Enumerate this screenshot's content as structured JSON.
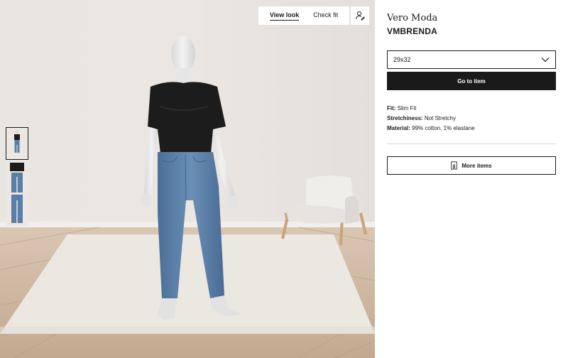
{
  "view_tabs": {
    "view_look": "View look",
    "check_fit": "Check fit",
    "active": "view_look"
  },
  "avatar_button": {
    "icon": "person-edit-icon"
  },
  "thumbnails": [
    {
      "name": "full-outfit",
      "active": true
    },
    {
      "name": "top-and-jeans",
      "active": false
    },
    {
      "name": "jeans-only",
      "active": false
    }
  ],
  "product": {
    "brand": "Vero Moda",
    "name": "VMBRENDA",
    "selected_size": "29x32",
    "go_to_item": "Go to item",
    "specs": [
      {
        "label": "Fit:",
        "value": "Slim Fit"
      },
      {
        "label": "Stretchiness:",
        "value": "Not Stretchy"
      },
      {
        "label": "Material:",
        "value": "99% cotton, 1% elastane"
      }
    ],
    "more_items": "More items",
    "more_items_icon": "pants-icon"
  },
  "colors": {
    "wall": "#e7e2de",
    "floor": "#c9b29c",
    "rug": "#ebe7e1",
    "top": "#1c1c1c",
    "denim": "#5a7fa6",
    "button_dark": "#1a1a1a"
  }
}
